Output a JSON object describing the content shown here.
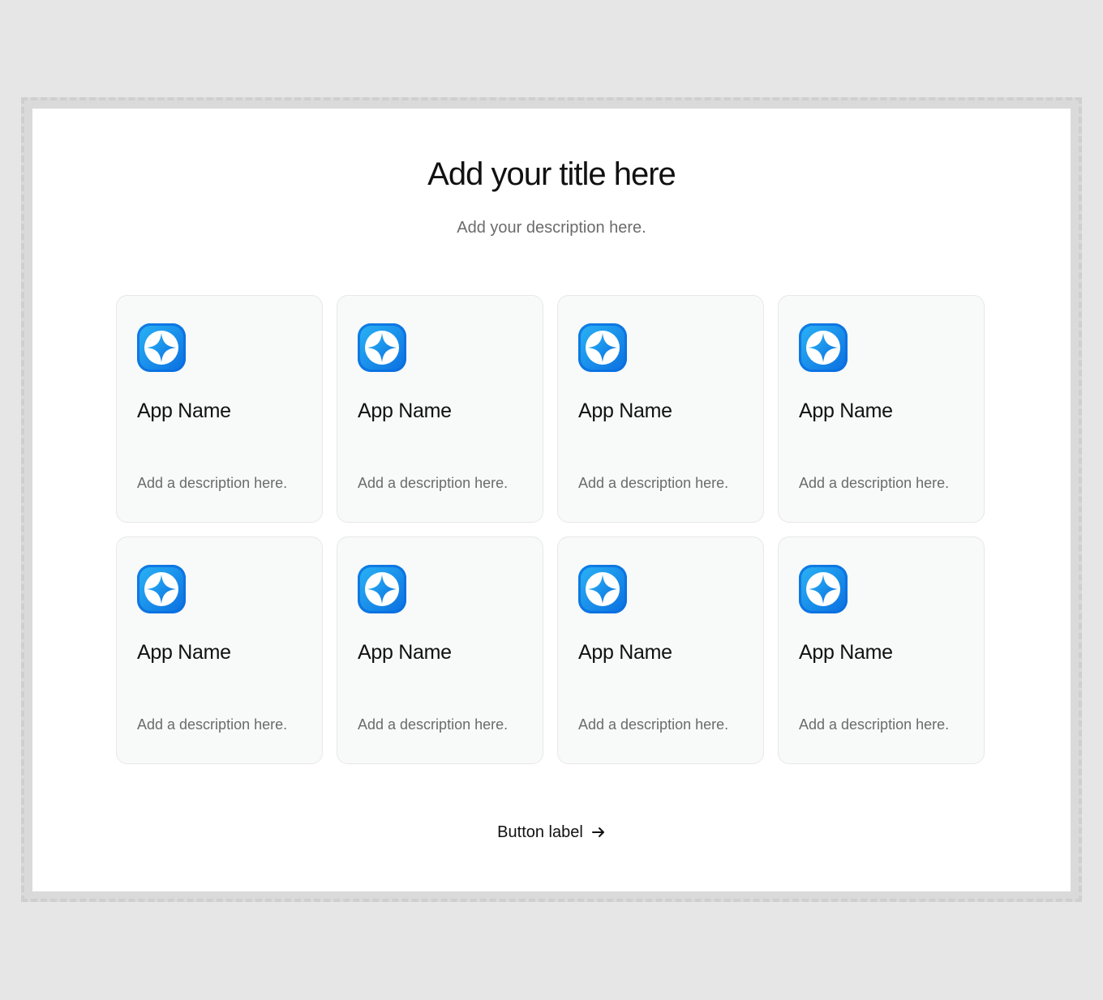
{
  "header": {
    "title": "Add your title here",
    "description": "Add your description here."
  },
  "cards": [
    {
      "name": "App Name",
      "description": "Add a description here.",
      "icon": "sparkle-app-icon"
    },
    {
      "name": "App Name",
      "description": "Add a description here.",
      "icon": "sparkle-app-icon"
    },
    {
      "name": "App Name",
      "description": "Add a description here.",
      "icon": "sparkle-app-icon"
    },
    {
      "name": "App Name",
      "description": "Add a description here.",
      "icon": "sparkle-app-icon"
    },
    {
      "name": "App Name",
      "description": "Add a description here.",
      "icon": "sparkle-app-icon"
    },
    {
      "name": "App Name",
      "description": "Add a description here.",
      "icon": "sparkle-app-icon"
    },
    {
      "name": "App Name",
      "description": "Add a description here.",
      "icon": "sparkle-app-icon"
    },
    {
      "name": "App Name",
      "description": "Add a description here.",
      "icon": "sparkle-app-icon"
    }
  ],
  "button": {
    "label": "Button label",
    "icon": "arrow-right-icon"
  },
  "colors": {
    "icon_blue_light": "#2bb4f5",
    "icon_blue_dark": "#0a6ee0",
    "card_background": "#f8f9f9",
    "page_background": "#e6e6e6"
  }
}
